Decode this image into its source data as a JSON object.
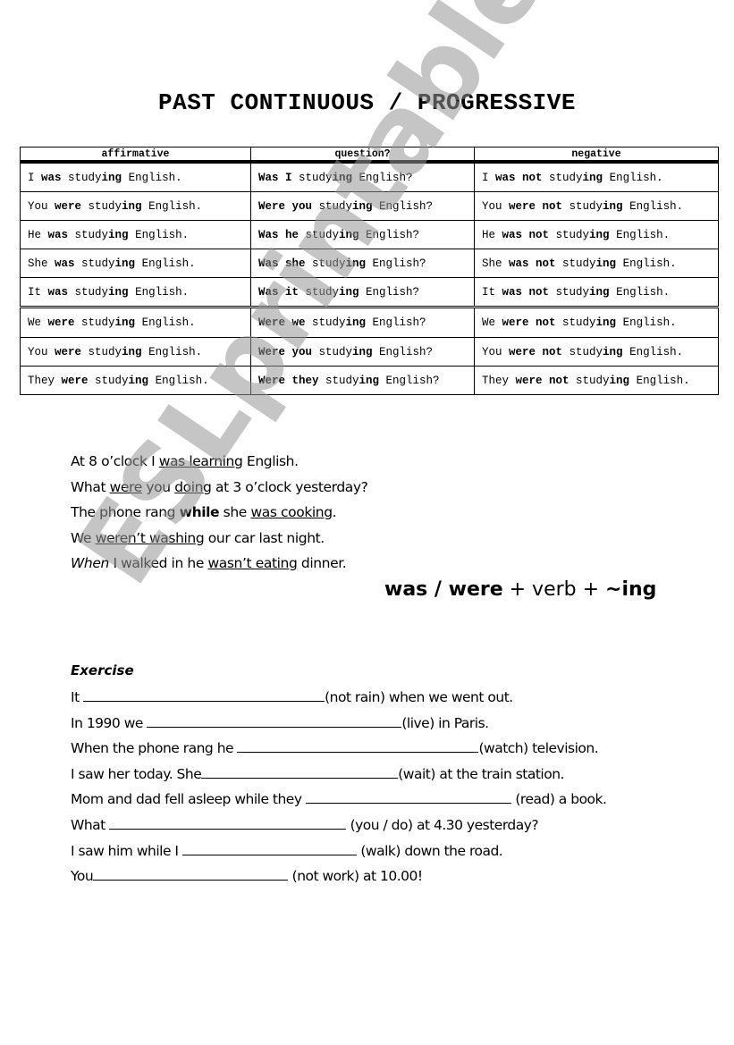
{
  "title": "PAST CONTINUOUS / PROGRESSIVE",
  "table": {
    "headers": [
      "affirmative",
      "question?",
      "negative"
    ],
    "group_break_before_row": 5,
    "rows": [
      [
        [
          [
            "I ",
            false
          ],
          [
            "was",
            true
          ],
          [
            " study",
            false
          ],
          [
            "ing",
            true
          ],
          [
            " English.",
            false
          ]
        ],
        [
          [
            "Was I",
            true
          ],
          [
            " study",
            false
          ],
          [
            "ing",
            true
          ],
          [
            " English?",
            false
          ]
        ],
        [
          [
            "I ",
            false
          ],
          [
            "was not",
            true
          ],
          [
            " study",
            false
          ],
          [
            "ing",
            true
          ],
          [
            " English.",
            false
          ]
        ]
      ],
      [
        [
          [
            "You ",
            false
          ],
          [
            "were",
            true
          ],
          [
            " study",
            false
          ],
          [
            "ing",
            true
          ],
          [
            " English.",
            false
          ]
        ],
        [
          [
            "Were you",
            true
          ],
          [
            " study",
            false
          ],
          [
            "ing",
            true
          ],
          [
            " English?",
            false
          ]
        ],
        [
          [
            "You ",
            false
          ],
          [
            "were not",
            true
          ],
          [
            " study",
            false
          ],
          [
            "ing",
            true
          ],
          [
            " English.",
            false
          ]
        ]
      ],
      [
        [
          [
            "He ",
            false
          ],
          [
            "was",
            true
          ],
          [
            " study",
            false
          ],
          [
            "ing",
            true
          ],
          [
            " English.",
            false
          ]
        ],
        [
          [
            "Was he",
            true
          ],
          [
            " study",
            false
          ],
          [
            "ing",
            true
          ],
          [
            " English?",
            false
          ]
        ],
        [
          [
            "He ",
            false
          ],
          [
            "was not",
            true
          ],
          [
            " study",
            false
          ],
          [
            "ing",
            true
          ],
          [
            " English.",
            false
          ]
        ]
      ],
      [
        [
          [
            "She ",
            false
          ],
          [
            "was",
            true
          ],
          [
            " study",
            false
          ],
          [
            "ing",
            true
          ],
          [
            " English.",
            false
          ]
        ],
        [
          [
            "Was she",
            true
          ],
          [
            " study",
            false
          ],
          [
            "ing",
            true
          ],
          [
            " English?",
            false
          ]
        ],
        [
          [
            "She ",
            false
          ],
          [
            "was not",
            true
          ],
          [
            " study",
            false
          ],
          [
            "ing",
            true
          ],
          [
            " English.",
            false
          ]
        ]
      ],
      [
        [
          [
            "It ",
            false
          ],
          [
            "was",
            true
          ],
          [
            " study",
            false
          ],
          [
            "ing",
            true
          ],
          [
            " English.",
            false
          ]
        ],
        [
          [
            "Was it",
            true
          ],
          [
            " study",
            false
          ],
          [
            "ing",
            true
          ],
          [
            " English?",
            false
          ]
        ],
        [
          [
            "It ",
            false
          ],
          [
            "was not",
            true
          ],
          [
            " study",
            false
          ],
          [
            "ing",
            true
          ],
          [
            " English.",
            false
          ]
        ]
      ],
      [
        [
          [
            "We ",
            false
          ],
          [
            "were",
            true
          ],
          [
            " study",
            false
          ],
          [
            "ing",
            true
          ],
          [
            " English.",
            false
          ]
        ],
        [
          [
            "Were we",
            true
          ],
          [
            " study",
            false
          ],
          [
            "ing",
            true
          ],
          [
            " English?",
            false
          ]
        ],
        [
          [
            "We ",
            false
          ],
          [
            "were not",
            true
          ],
          [
            " study",
            false
          ],
          [
            "ing",
            true
          ],
          [
            " English.",
            false
          ]
        ]
      ],
      [
        [
          [
            "You ",
            false
          ],
          [
            "were",
            true
          ],
          [
            " study",
            false
          ],
          [
            "ing",
            true
          ],
          [
            " English.",
            false
          ]
        ],
        [
          [
            "Were you",
            true
          ],
          [
            " study",
            false
          ],
          [
            "ing",
            true
          ],
          [
            " English?",
            false
          ]
        ],
        [
          [
            "You ",
            false
          ],
          [
            "were not",
            true
          ],
          [
            " study",
            false
          ],
          [
            "ing",
            true
          ],
          [
            " English.",
            false
          ]
        ]
      ],
      [
        [
          [
            "They ",
            false
          ],
          [
            "were",
            true
          ],
          [
            " study",
            false
          ],
          [
            "ing",
            true
          ],
          [
            " English.",
            false
          ]
        ],
        [
          [
            "Were they",
            true
          ],
          [
            " study",
            false
          ],
          [
            "ing",
            true
          ],
          [
            " English?",
            false
          ]
        ],
        [
          [
            "They ",
            false
          ],
          [
            "were not",
            true
          ],
          [
            " study",
            false
          ],
          [
            "ing",
            true
          ],
          [
            " English.",
            false
          ]
        ]
      ]
    ]
  },
  "examples": [
    [
      [
        "At 8 o’clock I ",
        ""
      ],
      [
        "was learning",
        "u"
      ],
      [
        " English.",
        ""
      ]
    ],
    [
      [
        "What ",
        ""
      ],
      [
        "were",
        "u"
      ],
      [
        " you ",
        ""
      ],
      [
        "doing",
        "u"
      ],
      [
        " at 3 o’clock yesterday?",
        ""
      ]
    ],
    [
      [
        "The phone rang ",
        ""
      ],
      [
        "while",
        "b"
      ],
      [
        " she ",
        ""
      ],
      [
        "was cooking",
        "u"
      ],
      [
        ".",
        ""
      ]
    ],
    [
      [
        "We ",
        ""
      ],
      [
        "weren’t washing",
        "u"
      ],
      [
        " our car last night.",
        ""
      ]
    ],
    [
      [
        "When",
        "i"
      ],
      [
        " I walked in he ",
        ""
      ],
      [
        "wasn’t eating",
        "u"
      ],
      [
        " dinner.",
        ""
      ]
    ]
  ],
  "formula": {
    "part1": "was / were",
    "part2": " + verb + ",
    "part3": "~ing"
  },
  "exercise": {
    "title": "Exercise",
    "items": [
      {
        "before": "It ",
        "after": "(not rain) when we went out."
      },
      {
        "before": "In 1990 we ",
        "after": "(live) in Paris."
      },
      {
        "before": "When the phone rang he ",
        "after": "(watch) television."
      },
      {
        "before": "I saw her today. She",
        "after": "(wait) at the train station."
      },
      {
        "before": "Mom and dad fell asleep while they ",
        "after": " (read) a book."
      },
      {
        "before": "What ",
        "after": " (you / do) at 4.30 yesterday?"
      },
      {
        "before": "I saw him while I ",
        "after": " (walk) down the road."
      },
      {
        "before": "You",
        "after": " (not work) at 10.00!"
      }
    ]
  },
  "watermark": "ESLprintables.com"
}
